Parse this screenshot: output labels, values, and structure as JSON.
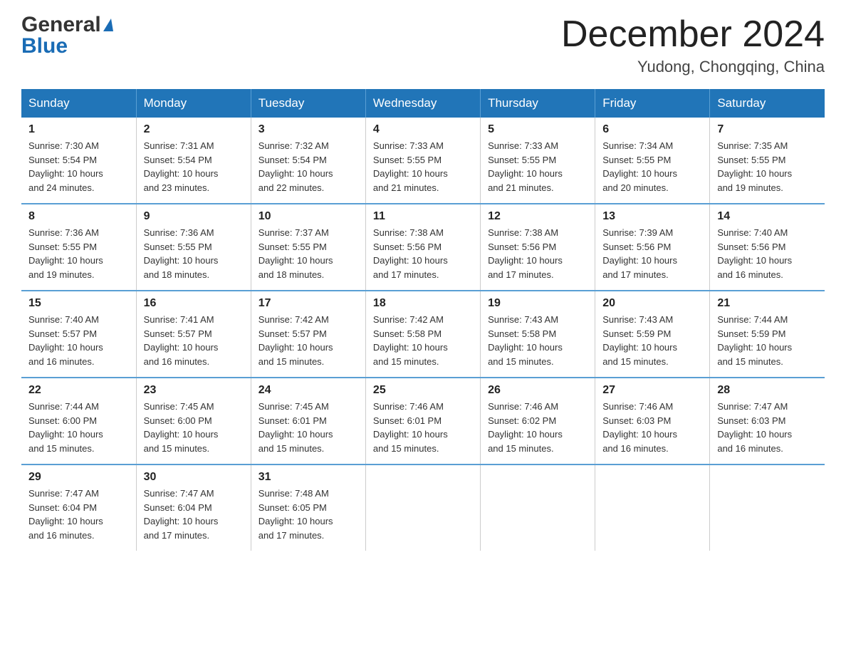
{
  "header": {
    "title": "December 2024",
    "subtitle": "Yudong, Chongqing, China",
    "logo_line1": "General",
    "logo_line2": "Blue"
  },
  "days_of_week": [
    "Sunday",
    "Monday",
    "Tuesday",
    "Wednesday",
    "Thursday",
    "Friday",
    "Saturday"
  ],
  "weeks": [
    [
      {
        "day": "1",
        "sunrise": "7:30 AM",
        "sunset": "5:54 PM",
        "daylight": "10 hours and 24 minutes."
      },
      {
        "day": "2",
        "sunrise": "7:31 AM",
        "sunset": "5:54 PM",
        "daylight": "10 hours and 23 minutes."
      },
      {
        "day": "3",
        "sunrise": "7:32 AM",
        "sunset": "5:54 PM",
        "daylight": "10 hours and 22 minutes."
      },
      {
        "day": "4",
        "sunrise": "7:33 AM",
        "sunset": "5:55 PM",
        "daylight": "10 hours and 21 minutes."
      },
      {
        "day": "5",
        "sunrise": "7:33 AM",
        "sunset": "5:55 PM",
        "daylight": "10 hours and 21 minutes."
      },
      {
        "day": "6",
        "sunrise": "7:34 AM",
        "sunset": "5:55 PM",
        "daylight": "10 hours and 20 minutes."
      },
      {
        "day": "7",
        "sunrise": "7:35 AM",
        "sunset": "5:55 PM",
        "daylight": "10 hours and 19 minutes."
      }
    ],
    [
      {
        "day": "8",
        "sunrise": "7:36 AM",
        "sunset": "5:55 PM",
        "daylight": "10 hours and 19 minutes."
      },
      {
        "day": "9",
        "sunrise": "7:36 AM",
        "sunset": "5:55 PM",
        "daylight": "10 hours and 18 minutes."
      },
      {
        "day": "10",
        "sunrise": "7:37 AM",
        "sunset": "5:55 PM",
        "daylight": "10 hours and 18 minutes."
      },
      {
        "day": "11",
        "sunrise": "7:38 AM",
        "sunset": "5:56 PM",
        "daylight": "10 hours and 17 minutes."
      },
      {
        "day": "12",
        "sunrise": "7:38 AM",
        "sunset": "5:56 PM",
        "daylight": "10 hours and 17 minutes."
      },
      {
        "day": "13",
        "sunrise": "7:39 AM",
        "sunset": "5:56 PM",
        "daylight": "10 hours and 17 minutes."
      },
      {
        "day": "14",
        "sunrise": "7:40 AM",
        "sunset": "5:56 PM",
        "daylight": "10 hours and 16 minutes."
      }
    ],
    [
      {
        "day": "15",
        "sunrise": "7:40 AM",
        "sunset": "5:57 PM",
        "daylight": "10 hours and 16 minutes."
      },
      {
        "day": "16",
        "sunrise": "7:41 AM",
        "sunset": "5:57 PM",
        "daylight": "10 hours and 16 minutes."
      },
      {
        "day": "17",
        "sunrise": "7:42 AM",
        "sunset": "5:57 PM",
        "daylight": "10 hours and 15 minutes."
      },
      {
        "day": "18",
        "sunrise": "7:42 AM",
        "sunset": "5:58 PM",
        "daylight": "10 hours and 15 minutes."
      },
      {
        "day": "19",
        "sunrise": "7:43 AM",
        "sunset": "5:58 PM",
        "daylight": "10 hours and 15 minutes."
      },
      {
        "day": "20",
        "sunrise": "7:43 AM",
        "sunset": "5:59 PM",
        "daylight": "10 hours and 15 minutes."
      },
      {
        "day": "21",
        "sunrise": "7:44 AM",
        "sunset": "5:59 PM",
        "daylight": "10 hours and 15 minutes."
      }
    ],
    [
      {
        "day": "22",
        "sunrise": "7:44 AM",
        "sunset": "6:00 PM",
        "daylight": "10 hours and 15 minutes."
      },
      {
        "day": "23",
        "sunrise": "7:45 AM",
        "sunset": "6:00 PM",
        "daylight": "10 hours and 15 minutes."
      },
      {
        "day": "24",
        "sunrise": "7:45 AM",
        "sunset": "6:01 PM",
        "daylight": "10 hours and 15 minutes."
      },
      {
        "day": "25",
        "sunrise": "7:46 AM",
        "sunset": "6:01 PM",
        "daylight": "10 hours and 15 minutes."
      },
      {
        "day": "26",
        "sunrise": "7:46 AM",
        "sunset": "6:02 PM",
        "daylight": "10 hours and 15 minutes."
      },
      {
        "day": "27",
        "sunrise": "7:46 AM",
        "sunset": "6:03 PM",
        "daylight": "10 hours and 16 minutes."
      },
      {
        "day": "28",
        "sunrise": "7:47 AM",
        "sunset": "6:03 PM",
        "daylight": "10 hours and 16 minutes."
      }
    ],
    [
      {
        "day": "29",
        "sunrise": "7:47 AM",
        "sunset": "6:04 PM",
        "daylight": "10 hours and 16 minutes."
      },
      {
        "day": "30",
        "sunrise": "7:47 AM",
        "sunset": "6:04 PM",
        "daylight": "10 hours and 17 minutes."
      },
      {
        "day": "31",
        "sunrise": "7:48 AM",
        "sunset": "6:05 PM",
        "daylight": "10 hours and 17 minutes."
      },
      null,
      null,
      null,
      null
    ]
  ],
  "labels": {
    "sunrise": "Sunrise:",
    "sunset": "Sunset:",
    "daylight": "Daylight:"
  },
  "colors": {
    "header_bg": "#2175b8",
    "header_text": "#ffffff",
    "border": "#5a9fd4"
  }
}
